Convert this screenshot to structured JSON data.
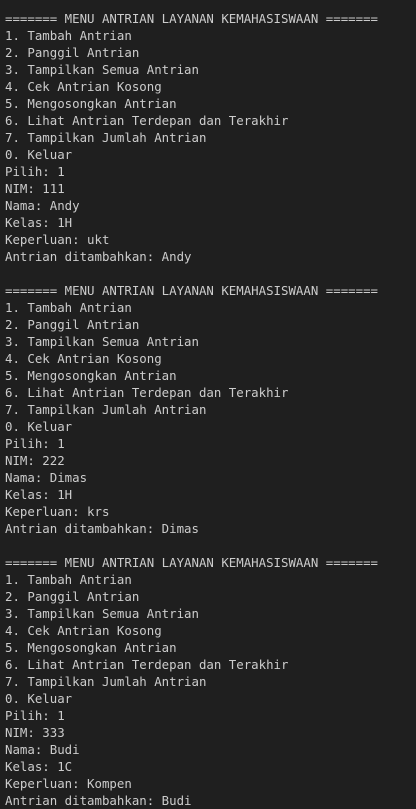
{
  "terminal": {
    "sessions": [
      {
        "header": "======= MENU ANTRIAN LAYANAN KEMAHASISWAAN =======",
        "menu": [
          "1. Tambah Antrian",
          "2. Panggil Antrian",
          "3. Tampilkan Semua Antrian",
          "4. Cek Antrian Kosong",
          "5. Mengosongkan Antrian",
          "6. Lihat Antrian Terdepan dan Terakhir",
          "7. Tampilkan Jumlah Antrian",
          "0. Keluar"
        ],
        "pilih": "Pilih: 1",
        "nim": "NIM: 111",
        "nama": "Nama: Andy",
        "kelas": "Kelas: 1H",
        "keperluan": "Keperluan: ukt",
        "result": "Antrian ditambahkan: Andy"
      },
      {
        "header": "======= MENU ANTRIAN LAYANAN KEMAHASISWAAN =======",
        "menu": [
          "1. Tambah Antrian",
          "2. Panggil Antrian",
          "3. Tampilkan Semua Antrian",
          "4. Cek Antrian Kosong",
          "5. Mengosongkan Antrian",
          "6. Lihat Antrian Terdepan dan Terakhir",
          "7. Tampilkan Jumlah Antrian",
          "0. Keluar"
        ],
        "pilih": "Pilih: 1",
        "nim": "NIM: 222",
        "nama": "Nama: Dimas",
        "kelas": "Kelas: 1H",
        "keperluan": "Keperluan: krs",
        "result": "Antrian ditambahkan: Dimas"
      },
      {
        "header": "======= MENU ANTRIAN LAYANAN KEMAHASISWAAN =======",
        "menu": [
          "1. Tambah Antrian",
          "2. Panggil Antrian",
          "3. Tampilkan Semua Antrian",
          "4. Cek Antrian Kosong",
          "5. Mengosongkan Antrian",
          "6. Lihat Antrian Terdepan dan Terakhir",
          "7. Tampilkan Jumlah Antrian",
          "0. Keluar"
        ],
        "pilih": "Pilih: 1",
        "nim": "NIM: 333",
        "nama": "Nama: Budi",
        "kelas": "Kelas: 1C",
        "keperluan": "Keperluan: Kompen",
        "result": "Antrian ditambahkan: Budi"
      }
    ]
  }
}
